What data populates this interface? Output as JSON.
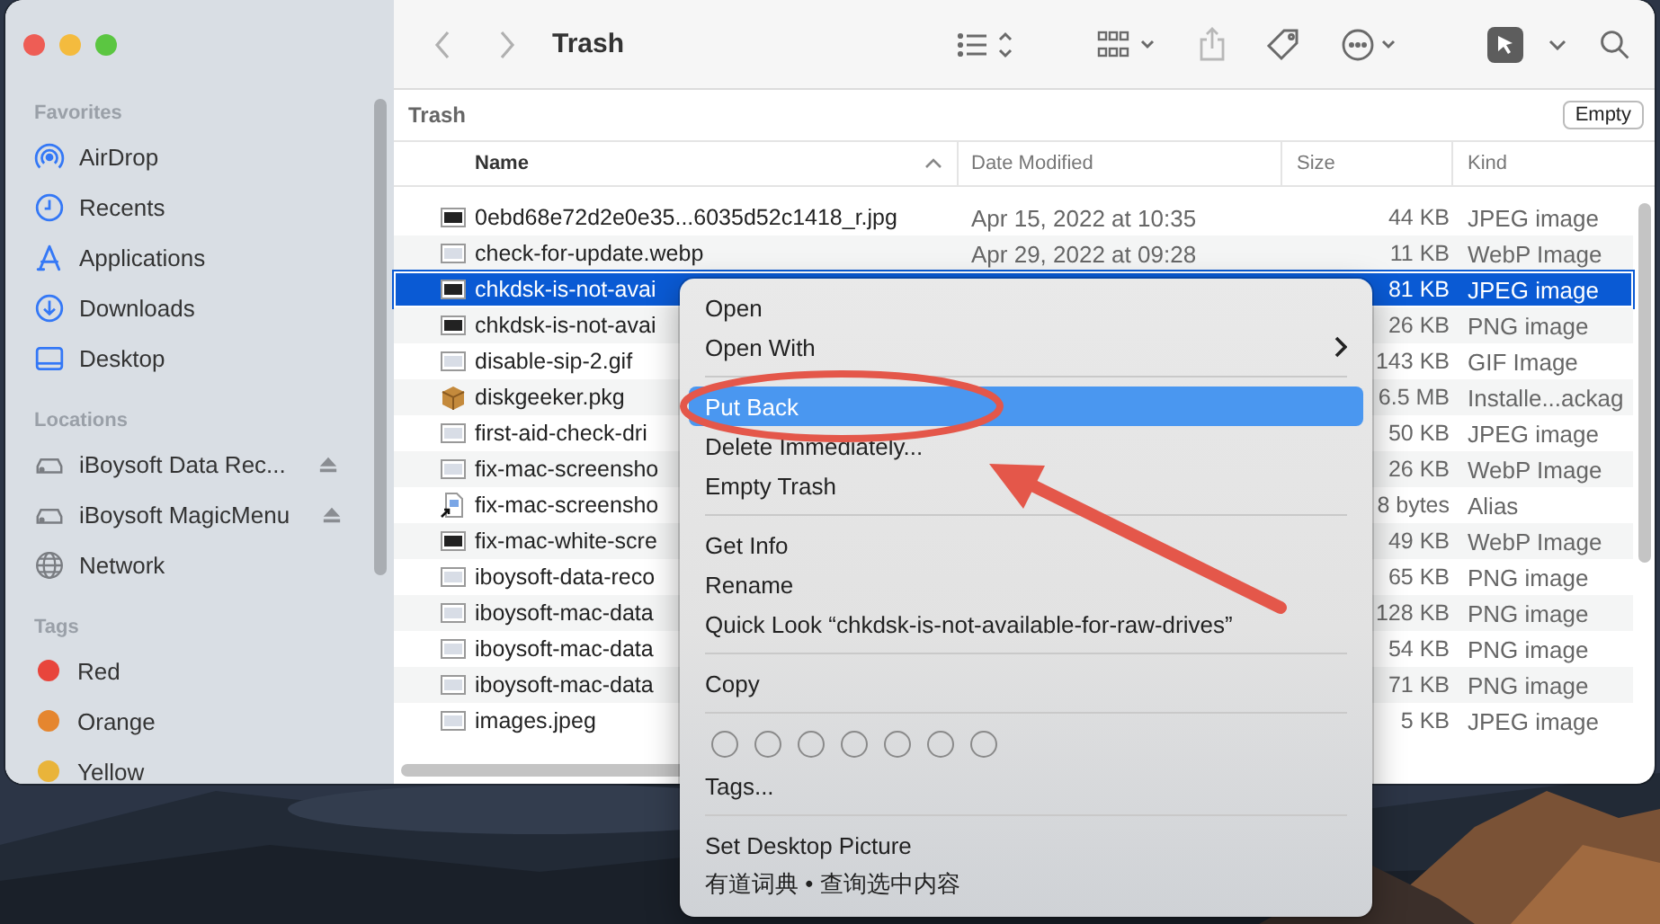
{
  "window": {
    "title": "Trash"
  },
  "sidebar": {
    "sections": [
      {
        "heading": "Favorites",
        "items": [
          {
            "label": "AirDrop",
            "kind": "airdrop"
          },
          {
            "label": "Recents",
            "kind": "recents"
          },
          {
            "label": "Applications",
            "kind": "applications"
          },
          {
            "label": "Downloads",
            "kind": "downloads"
          },
          {
            "label": "Desktop",
            "kind": "desktop"
          }
        ]
      },
      {
        "heading": "Locations",
        "items": [
          {
            "label": "iBoysoft Data Rec...",
            "kind": "drive",
            "ejectable": true
          },
          {
            "label": "iBoysoft MagicMenu",
            "kind": "drive",
            "ejectable": true
          },
          {
            "label": "Network",
            "kind": "network",
            "ejectable": false
          }
        ]
      },
      {
        "heading": "Tags",
        "items": [
          {
            "label": "Red",
            "kind": "tag",
            "color": "#e8453c"
          },
          {
            "label": "Orange",
            "kind": "tag",
            "color": "#e5862f"
          },
          {
            "label": "Yellow",
            "kind": "tag",
            "color": "#e9b43a"
          }
        ]
      }
    ]
  },
  "path_bar": {
    "location": "Trash",
    "button": "Empty"
  },
  "table": {
    "columns": [
      {
        "label": "Name",
        "sorted": true
      },
      {
        "label": "Date Modified",
        "sorted": false
      },
      {
        "label": "Size",
        "sorted": false
      },
      {
        "label": "Kind",
        "sorted": false
      }
    ],
    "rows": [
      {
        "kind": "dark",
        "name": "0ebd68e72d2e0e35...6035d52c1418_r.jpg",
        "date_modified": "Apr 15, 2022 at 10:35",
        "size": "44 KB",
        "file_type": "JPEG image",
        "selected": false
      },
      {
        "kind": "light",
        "name": "check-for-update.webp",
        "date_modified": "Apr 29, 2022 at 09:28",
        "size": "11 KB",
        "file_type": "WebP Image",
        "selected": false
      },
      {
        "kind": "dark",
        "name": "chkdsk-is-not-avai",
        "size": "81 KB",
        "file_type": "JPEG image",
        "selected": true
      },
      {
        "kind": "dark",
        "name": "chkdsk-is-not-avai",
        "size": "26 KB",
        "file_type": "PNG image",
        "selected": false
      },
      {
        "kind": "light",
        "name": "disable-sip-2.gif",
        "size": "143 KB",
        "file_type": "GIF Image",
        "selected": false
      },
      {
        "kind": "package",
        "name": "diskgeeker.pkg",
        "size": "6.5 MB",
        "file_type": "Installe...ackag",
        "selected": false
      },
      {
        "kind": "light",
        "name": "first-aid-check-dri",
        "size": "50 KB",
        "file_type": "JPEG image",
        "selected": false
      },
      {
        "kind": "light",
        "name": "fix-mac-screensho",
        "size": "26 KB",
        "file_type": "WebP Image",
        "selected": false
      },
      {
        "kind": "alias",
        "name": "fix-mac-screensho",
        "size": "8 bytes",
        "file_type": "Alias",
        "selected": false
      },
      {
        "kind": "dark",
        "name": "fix-mac-white-scre",
        "size": "49 KB",
        "file_type": "WebP Image",
        "selected": false
      },
      {
        "kind": "light",
        "name": "iboysoft-data-reco",
        "size": "65 KB",
        "file_type": "PNG image",
        "selected": false
      },
      {
        "kind": "light",
        "name": "iboysoft-mac-data",
        "size": "128 KB",
        "file_type": "PNG image",
        "selected": false
      },
      {
        "kind": "light",
        "name": "iboysoft-mac-data",
        "size": "54 KB",
        "file_type": "PNG image",
        "selected": false
      },
      {
        "kind": "light",
        "name": "iboysoft-mac-data",
        "size": "71 KB",
        "file_type": "PNG image",
        "selected": false
      },
      {
        "kind": "light",
        "name": "images.jpeg",
        "size": "5 KB",
        "file_type": "JPEG image",
        "selected": false
      }
    ]
  },
  "context_menu": {
    "items": [
      {
        "kind": "item",
        "label": "Open",
        "selected": false,
        "submenu": false
      },
      {
        "kind": "item",
        "label": "Open With",
        "selected": false,
        "submenu": true
      },
      {
        "kind": "separator"
      },
      {
        "kind": "item",
        "label": "Put Back",
        "selected": true,
        "submenu": false
      },
      {
        "kind": "item",
        "label": "Delete Immediately...",
        "selected": false,
        "submenu": false
      },
      {
        "kind": "item",
        "label": "Empty Trash",
        "selected": false,
        "submenu": false
      },
      {
        "kind": "separator"
      },
      {
        "kind": "item",
        "label": "Get Info",
        "selected": false,
        "submenu": false
      },
      {
        "kind": "item",
        "label": "Rename",
        "selected": false,
        "submenu": false
      },
      {
        "kind": "item",
        "label": "Quick Look “chkdsk-is-not-available-for-raw-drives”",
        "selected": false,
        "submenu": false
      },
      {
        "kind": "separator"
      },
      {
        "kind": "item",
        "label": "Copy",
        "selected": false,
        "submenu": false
      },
      {
        "kind": "separator"
      },
      {
        "kind": "tag_circles"
      },
      {
        "kind": "item",
        "label": "Tags...",
        "selected": false,
        "submenu": false
      },
      {
        "kind": "separator"
      },
      {
        "kind": "item",
        "label": "Set Desktop Picture",
        "selected": false,
        "submenu": false
      },
      {
        "kind": "item",
        "label": "有道词典 • 查询选中内容",
        "selected": false,
        "submenu": false
      }
    ]
  }
}
